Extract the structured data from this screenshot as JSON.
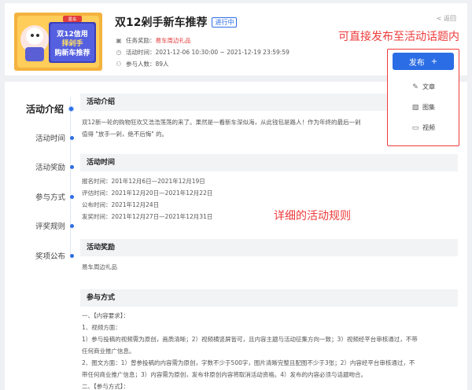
{
  "header": {
    "cover_lines": [
      "双12信用",
      "择剁手",
      "购新车推荐"
    ],
    "cover_badge": "易车",
    "title": "双12剁手新车推荐",
    "status": "进行中",
    "back": "< 返回",
    "task_label": "任务奖励：",
    "task_value": "易车周边礼品",
    "time_label": "活动时间：",
    "time_value": "2021-12-06 10:30:00 ~ 2021-12-19 23:59:59",
    "people_label": "参与人数：",
    "people_value": "89人"
  },
  "annotations": {
    "publish_note": "可直接发布至活动话题内",
    "rules_note": "详细的活动规则"
  },
  "publish": {
    "button_label": "发布",
    "plus": "+",
    "items": [
      {
        "label": "文章",
        "icon": "pen-icon"
      },
      {
        "label": "图集",
        "icon": "gallery-icon"
      },
      {
        "label": "视频",
        "icon": "video-icon"
      }
    ]
  },
  "sidenav": {
    "items": [
      "活动介绍",
      "活动时间",
      "活动奖励",
      "参与方式",
      "评奖规则",
      "奖项公布"
    ]
  },
  "sections": {
    "intro": {
      "title": "活动介绍",
      "lines": [
        "双12新一轮的购物狂欢又浩浩荡荡的来了。果然是一看新车深似海，从此钱包是路人！作为年终的最后一剁",
        "值得 \"放手一剁，绝不后悔\" 的。"
      ]
    },
    "time": {
      "title": "活动时间",
      "lines": [
        "报名时间：201年12月6日—2021年12月19日",
        "评估时间：2021年12月20日—2021年12月22日",
        "公布时间：2021年12月24日",
        "发奖时间：2021年12月27日—2021年12月31日"
      ]
    },
    "reward": {
      "title": "活动奖励",
      "lines": [
        "易车周边礼品"
      ]
    },
    "method": {
      "title": "参与方式",
      "lines": [
        "一、【内容要求】：",
        "1、视频方面：",
        "1）参与投稿的视频需为原创，画质清晰；2）视频横竖屏皆可，且内容主题与活动征集方向一致；3）视频经平台审核通过，不带",
        "任何商业推广信息。",
        "2、图文方面：1）曾参投稿的内容需为原创，字数不少于500字，图片清晰完整且配图不少于3张；2）内容经平台审核通过，不",
        "带任何商业推广信息；3）内容需为原创，发布非原创内容将取消活动资格。4）发布的内容必须与话题吻合。",
        "二、【参与方式】："
      ]
    }
  }
}
